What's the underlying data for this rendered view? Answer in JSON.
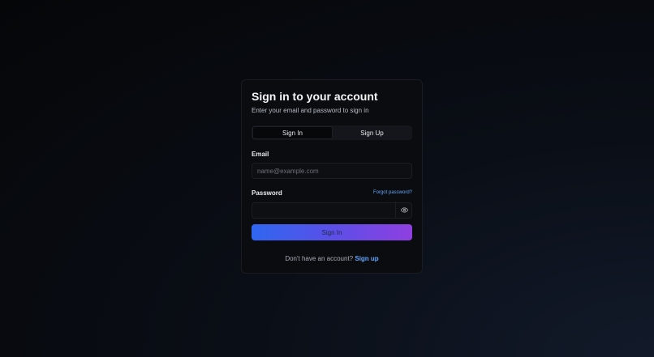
{
  "card": {
    "title": "Sign in to your account",
    "subtitle": "Enter your email and password to sign in"
  },
  "tabs": [
    {
      "label": "Sign In",
      "active": true
    },
    {
      "label": "Sign Up",
      "active": false
    }
  ],
  "email": {
    "label": "Email",
    "placeholder": "name@example.com",
    "value": ""
  },
  "password": {
    "label": "Password",
    "forgot_label": "Forgot password?",
    "value": "",
    "toggle_icon": "eye-icon"
  },
  "submit_label": "Sign In",
  "footer": {
    "prompt": "Don't have an account?",
    "link_label": "Sign up"
  },
  "colors": {
    "accent_link": "#60a5fa",
    "gradient_start": "#2f67f0",
    "gradient_end": "#8f3fe0"
  }
}
